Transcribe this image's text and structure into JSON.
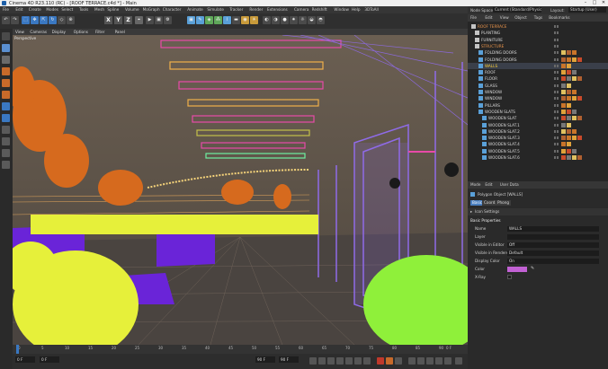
{
  "window": {
    "title": "Cinema 4D R23.110 (RC) - [ROOF TERRACE.c4d *] - Main",
    "minimize": "–",
    "maximize": "□",
    "close": "✕"
  },
  "menus": [
    "File",
    "Edit",
    "Create",
    "Modes",
    "Select",
    "Tools",
    "Mesh",
    "Spline",
    "Volume",
    "MoGraph",
    "Character",
    "Animate",
    "Simulate",
    "Tracker",
    "Render",
    "Extensions",
    "Camera",
    "Redshift",
    "Window",
    "Help",
    "3DToAll"
  ],
  "node_space": {
    "label": "Node Space:",
    "value": "Current (Standard/Physical)",
    "layout_label": "Layout:",
    "layout_value": "Startup (User)"
  },
  "toolbar": {
    "axis_x": "X",
    "axis_y": "Y",
    "axis_z": "Z"
  },
  "viewport": {
    "menu": [
      "View",
      "Cameras",
      "Display",
      "Options",
      "Filter",
      "Panel"
    ],
    "label": "Perspective"
  },
  "object_manager": {
    "menu": [
      "File",
      "Edit",
      "View",
      "Object",
      "Tags",
      "Bookmarks"
    ],
    "objects": [
      {
        "name": "ROOF TERRACE",
        "level": 0,
        "active": false,
        "color": "#d4732a"
      },
      {
        "name": "PLANTING",
        "level": 1,
        "active": false,
        "color": "#8a8a8a"
      },
      {
        "name": "FURNITURE",
        "level": 1,
        "active": false,
        "color": "#8a8a8a"
      },
      {
        "name": "STRUCTURE",
        "level": 1,
        "active": false,
        "color": "#d4732a"
      },
      {
        "name": "FOLDING DOORS",
        "level": 2,
        "active": false,
        "color": "#8a8a8a"
      },
      {
        "name": "FOLDING DOORS",
        "level": 2,
        "active": false,
        "color": "#8a8a8a"
      },
      {
        "name": "WALLS",
        "level": 2,
        "active": true,
        "color": "#8a8a8a"
      },
      {
        "name": "ROOF",
        "level": 2,
        "active": false,
        "color": "#8a8a8a"
      },
      {
        "name": "FLOOR",
        "level": 2,
        "active": false,
        "color": "#8a8a8a"
      },
      {
        "name": "GLASS",
        "level": 2,
        "active": false,
        "color": "#8a8a8a"
      },
      {
        "name": "WINDOW",
        "level": 2,
        "active": false,
        "color": "#8a8a8a"
      },
      {
        "name": "WINDOW",
        "level": 2,
        "active": false,
        "color": "#8a8a8a"
      },
      {
        "name": "PILLARS",
        "level": 2,
        "active": false,
        "color": "#8a8a8a"
      },
      {
        "name": "WOODEN SLATS",
        "level": 2,
        "active": false,
        "color": "#8a8a8a"
      },
      {
        "name": "WOODEN SLAT",
        "level": 3,
        "active": false,
        "color": "#8a8a8a"
      },
      {
        "name": "WOODEN SLAT.1",
        "level": 3,
        "active": false,
        "color": "#8a8a8a"
      },
      {
        "name": "WOODEN SLAT.2",
        "level": 3,
        "active": false,
        "color": "#8a8a8a"
      },
      {
        "name": "WOODEN SLAT.3",
        "level": 3,
        "active": false,
        "color": "#8a8a8a"
      },
      {
        "name": "WOODEN SLAT.4",
        "level": 3,
        "active": false,
        "color": "#8a8a8a"
      },
      {
        "name": "WOODEN SLAT.5",
        "level": 3,
        "active": false,
        "color": "#8a8a8a"
      },
      {
        "name": "WOODEN SLAT.6",
        "level": 3,
        "active": false,
        "color": "#8a8a8a"
      }
    ]
  },
  "attributes": {
    "menu": [
      "Mode",
      "Edit",
      "User Data"
    ],
    "title": "Polygon Object [WALLS]",
    "tabs": [
      {
        "label": "Basic",
        "active": true
      },
      {
        "label": "Coord.",
        "active": false
      },
      {
        "label": "Phong",
        "active": false
      }
    ],
    "section": "Icon Settings",
    "group": "Basic Properties",
    "fields": [
      {
        "label": "Name",
        "value": "WALLS"
      },
      {
        "label": "Layer",
        "value": ""
      },
      {
        "label": "Visible in Editor",
        "value": "Off"
      },
      {
        "label": "Visible in Renderer",
        "value": "Default"
      },
      {
        "label": "Display Color",
        "value": "On"
      },
      {
        "label": "Color",
        "value": ""
      },
      {
        "label": "X-Ray",
        "value": ""
      }
    ],
    "color_swatch": "#c261d4"
  },
  "timeline": {
    "ticks": [
      "0",
      "5",
      "10",
      "15",
      "20",
      "25",
      "30",
      "35",
      "40",
      "45",
      "50",
      "55",
      "60",
      "65",
      "70",
      "75",
      "80",
      "85",
      "90"
    ],
    "end_label": "0 F"
  },
  "transport": {
    "start": "0 F",
    "current": "0 F",
    "end": "90 F",
    "end2": "90 F"
  },
  "colors": {
    "walls_purple": "#8f6be8",
    "plant_yellow": "#e6f03a",
    "plant_orange": "#d66a1e",
    "plant_green": "#8ff03a",
    "floor_blue": "#6a24d8",
    "roof_pink": "#e84aa8",
    "accent": "#3a78c2"
  }
}
